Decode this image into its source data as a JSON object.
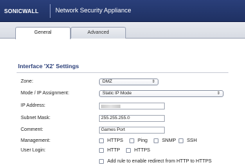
{
  "header": {
    "logo_text": "SONICWALL",
    "title": "Network Security Appliance"
  },
  "tabs": [
    {
      "label": "General",
      "active": true
    },
    {
      "label": "Advanced",
      "active": false
    }
  ],
  "section": {
    "title": "Interface 'X2' Settings"
  },
  "form": {
    "zone": {
      "label": "Zone:",
      "value": "DMZ"
    },
    "mode": {
      "label": "Mode / IP Assignment:",
      "value": "Static IP Mode"
    },
    "ip_address": {
      "label": "IP Address:",
      "value": ""
    },
    "subnet_mask": {
      "label": "Subnet Mask:",
      "value": "255.255.255.0"
    },
    "comment": {
      "label": "Comment:",
      "value": "Games Port"
    },
    "management": {
      "label": "Management:",
      "options": [
        {
          "label": "HTTPS",
          "checked": false
        },
        {
          "label": "Ping",
          "checked": false
        },
        {
          "label": "SNMP",
          "checked": false
        },
        {
          "label": "SSH",
          "checked": false
        }
      ]
    },
    "user_login": {
      "label": "User Login:",
      "options": [
        {
          "label": "HTTP",
          "checked": false
        },
        {
          "label": "HTTPS",
          "checked": false
        }
      ]
    },
    "redirect": {
      "label": "Add rule to enable redirect from HTTP to HTTPS",
      "checked": false
    }
  },
  "colors": {
    "header_bg": "#1f3163",
    "section_title": "#2b3f79"
  }
}
